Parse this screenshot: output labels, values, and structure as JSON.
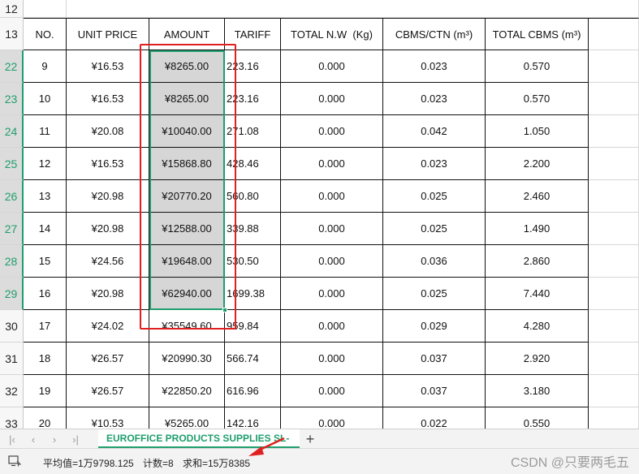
{
  "colors": {
    "accent": "#1f9e6d",
    "annotation": "#e02020",
    "selected_fill": "#d6d6d6"
  },
  "header_row": {
    "row_number": "13",
    "columns": [
      "NO.",
      "UNIT PRICE",
      "AMOUNT",
      "TARIFF",
      "TOTAL N.W  (Kg)",
      "CBMS/CTN (m³)",
      "TOTAL CBMS (m³)"
    ]
  },
  "top_row_number": "12",
  "rows": [
    {
      "row_number": "22",
      "cells": [
        "9",
        "¥16.53",
        "¥8265.00",
        "223.16",
        "0.000",
        "0.023",
        "0.570"
      ],
      "selected": true
    },
    {
      "row_number": "23",
      "cells": [
        "10",
        "¥16.53",
        "¥8265.00",
        "223.16",
        "0.000",
        "0.023",
        "0.570"
      ],
      "selected": true
    },
    {
      "row_number": "24",
      "cells": [
        "11",
        "¥20.08",
        "¥10040.00",
        "271.08",
        "0.000",
        "0.042",
        "1.050"
      ],
      "selected": true
    },
    {
      "row_number": "25",
      "cells": [
        "12",
        "¥16.53",
        "¥15868.80",
        "428.46",
        "0.000",
        "0.023",
        "2.200"
      ],
      "selected": true
    },
    {
      "row_number": "26",
      "cells": [
        "13",
        "¥20.98",
        "¥20770.20",
        "560.80",
        "0.000",
        "0.025",
        "2.460"
      ],
      "selected": true
    },
    {
      "row_number": "27",
      "cells": [
        "14",
        "¥20.98",
        "¥12588.00",
        "339.88",
        "0.000",
        "0.025",
        "1.490"
      ],
      "selected": true
    },
    {
      "row_number": "28",
      "cells": [
        "15",
        "¥24.56",
        "¥19648.00",
        "530.50",
        "0.000",
        "0.036",
        "2.860"
      ],
      "selected": true
    },
    {
      "row_number": "29",
      "cells": [
        "16",
        "¥20.98",
        "¥62940.00",
        "1699.38",
        "0.000",
        "0.025",
        "7.440"
      ],
      "selected": true
    },
    {
      "row_number": "30",
      "cells": [
        "17",
        "¥24.02",
        "¥35549.60",
        "959.84",
        "0.000",
        "0.029",
        "4.280"
      ],
      "selected": false
    },
    {
      "row_number": "31",
      "cells": [
        "18",
        "¥26.57",
        "¥20990.30",
        "566.74",
        "0.000",
        "0.037",
        "2.920"
      ],
      "selected": false
    },
    {
      "row_number": "32",
      "cells": [
        "19",
        "¥26.57",
        "¥22850.20",
        "616.96",
        "0.000",
        "0.037",
        "3.180"
      ],
      "selected": false
    },
    {
      "row_number": "33",
      "cells": [
        "20",
        "¥10.53",
        "¥5265.00",
        "142.16",
        "0.000",
        "0.022",
        "0.550"
      ],
      "selected": false
    }
  ],
  "tabs": {
    "nav_icons": [
      "first-sheet-icon",
      "prev-sheet-icon",
      "next-sheet-icon",
      "last-sheet-icon"
    ],
    "active_sheet": "EUROFFICE PRODUCTS SUPPLIES SL-",
    "add_label": "+"
  },
  "status": {
    "average": "平均值=1万9798.125",
    "count": "计数=8",
    "sum": "求和=15万8385"
  },
  "watermark": "CSDN @只要两毛五"
}
